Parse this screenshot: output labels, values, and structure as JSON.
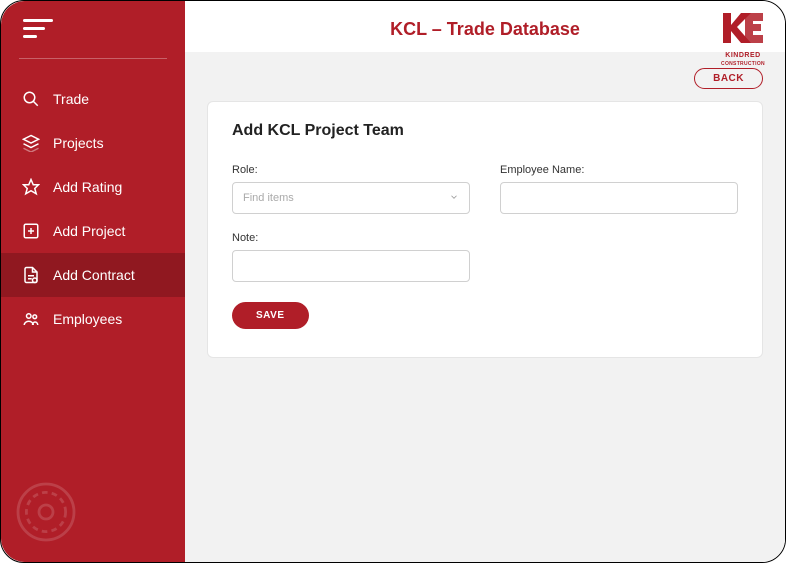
{
  "header": {
    "title": "KCL – Trade Database",
    "logo_text": "KINDRED",
    "logo_sub": "CONSTRUCTION"
  },
  "sidebar": {
    "items": [
      {
        "label": "Trade"
      },
      {
        "label": "Projects"
      },
      {
        "label": "Add Rating"
      },
      {
        "label": "Add Project"
      },
      {
        "label": "Add Contract"
      },
      {
        "label": "Employees"
      }
    ]
  },
  "page": {
    "back_label": "BACK",
    "card_title": "Add KCL Project Team",
    "role_label": "Role:",
    "role_placeholder": "Find items",
    "emp_label": "Employee Name:",
    "note_label": "Note:",
    "save_label": "SAVE"
  },
  "colors": {
    "brand": "#b01e28"
  }
}
